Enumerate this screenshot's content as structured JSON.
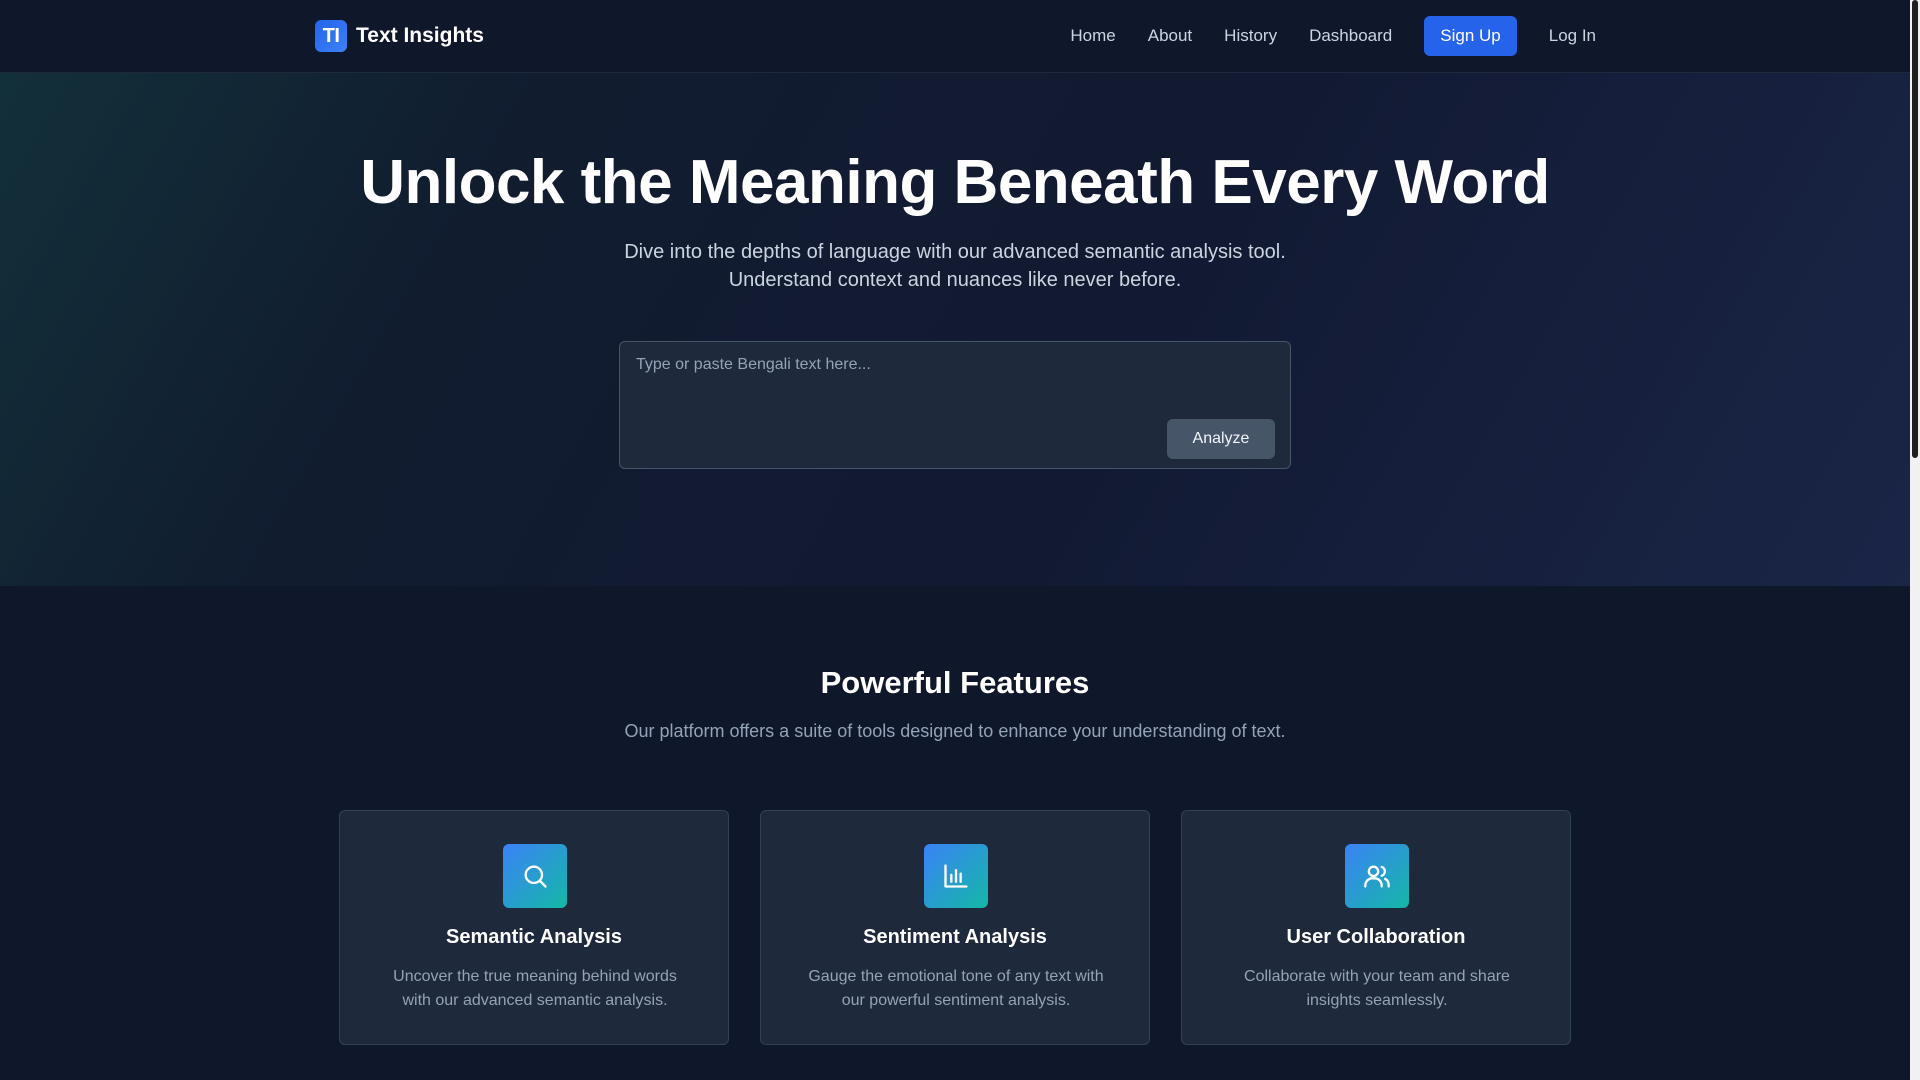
{
  "header": {
    "logo_badge": "TI",
    "logo_text": "Text Insights",
    "nav": {
      "home": "Home",
      "about": "About",
      "history": "History",
      "dashboard": "Dashboard",
      "signup": "Sign Up",
      "login": "Log In"
    }
  },
  "hero": {
    "title": "Unlock the Meaning Beneath Every Word",
    "subtitle_line1": "Dive into the depths of language with our advanced semantic analysis tool.",
    "subtitle_line2": "Understand context and nuances like never before.",
    "input_placeholder": "Type or paste Bengali text here...",
    "analyze_label": "Analyze"
  },
  "features": {
    "title": "Powerful Features",
    "subtitle": "Our platform offers a suite of tools designed to enhance your understanding of text.",
    "cards": [
      {
        "icon": "search-icon",
        "title": "Semantic Analysis",
        "description": "Uncover the true meaning behind words with our advanced semantic analysis."
      },
      {
        "icon": "bar-chart-icon",
        "title": "Sentiment Analysis",
        "description": "Gauge the emotional tone of any text with our powerful sentiment analysis."
      },
      {
        "icon": "users-icon",
        "title": "User Collaboration",
        "description": "Collaborate with your team and share insights seamlessly."
      }
    ]
  },
  "colors": {
    "background": "#0f172a",
    "accent": "#2563eb",
    "card_background": "#1e293b",
    "icon_gradient_start": "#3b82f6",
    "icon_gradient_end": "#14b8a6"
  }
}
